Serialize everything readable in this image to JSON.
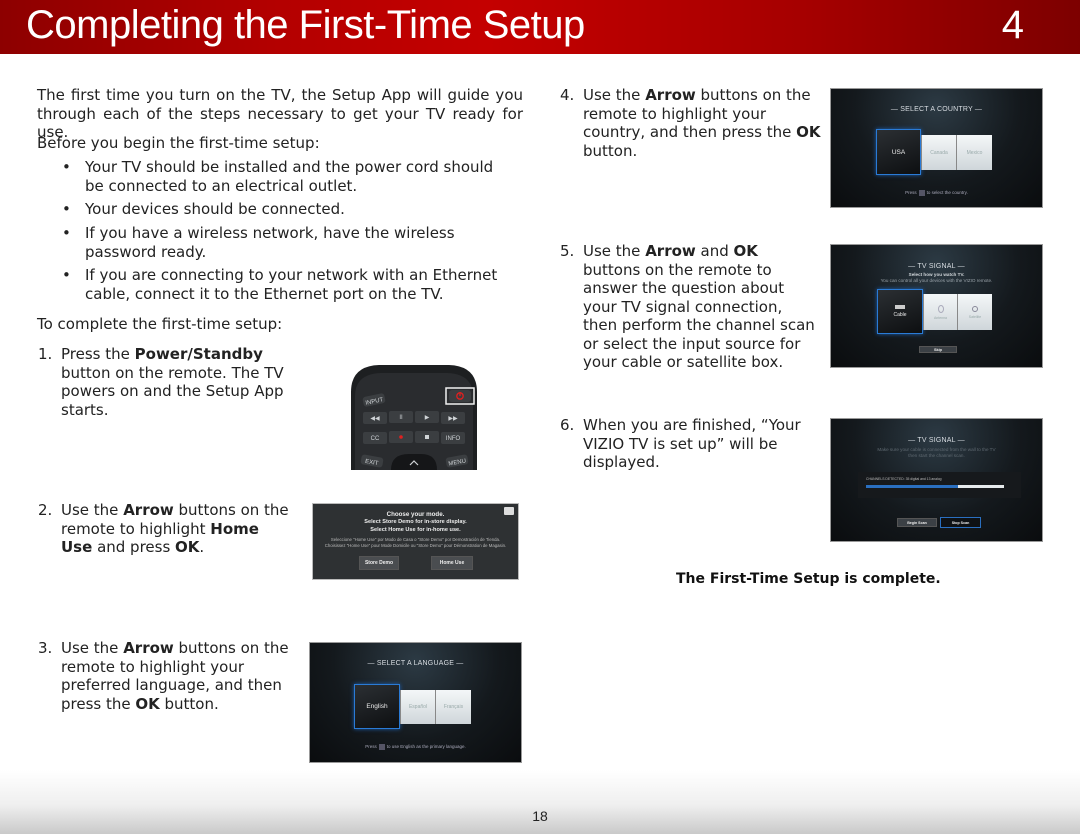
{
  "header": {
    "title": "Completing the First-Time Setup",
    "chapter_number": "4"
  },
  "intro": {
    "paragraph": "The first time you turn on the TV, the Setup App will guide you through each of the steps necessary to get your TV ready for use.",
    "before_label": "Before you begin the first-time setup:",
    "bullets": [
      "Your TV should be installed and the power cord should be connected to an electrical outlet.",
      "Your devices should be connected.",
      "If you have a wireless network, have the wireless password ready.",
      "If you are connecting to your network with an Ethernet cable, connect it to the Ethernet port on the TV."
    ],
    "bullet_glyph": "•",
    "complete_label": "To complete the first-time setup:"
  },
  "steps": [
    {
      "number": "1.",
      "parts": [
        "Press the ",
        "Power/Standby",
        " button on the remote. The TV powers on and the Setup App starts."
      ]
    },
    {
      "number": "2.",
      "parts": [
        "Use the ",
        "Arrow",
        " buttons on the remote to highlight ",
        "Home Use",
        " and press ",
        "OK",
        "."
      ]
    },
    {
      "number": "3.",
      "parts": [
        "Use the ",
        "Arrow",
        " buttons on the remote to highlight your preferred language, and then press the ",
        "OK",
        " button."
      ]
    },
    {
      "number": "4.",
      "parts": [
        "Use the ",
        "Arrow",
        " buttons on the remote to highlight your country, and then press the ",
        "OK",
        " button."
      ]
    },
    {
      "number": "5.",
      "parts": [
        "Use the ",
        "Arrow",
        " and ",
        "OK",
        " buttons on the remote to answer the question about your TV signal connection, then perform the channel scan or select the input source for your cable or satellite box."
      ]
    },
    {
      "number": "6.",
      "parts": [
        "When you are finished, “Your VIZIO TV is set up” will be displayed."
      ]
    }
  ],
  "remote": {
    "buttons": [
      "INPUT",
      "⏪",
      "II",
      "▶",
      "⏩",
      "CC",
      "●",
      "■",
      "INFO",
      "EXIT",
      "^",
      "MENU"
    ],
    "power_color": "#e02020"
  },
  "mode_screen": {
    "title": "Choose your mode.",
    "line1": "Select Store Demo for in-store display.",
    "line2": "Select Home Use for in-home use.",
    "spanish": "Seleccione \"Home Use\" por Modo de Casa o \"Store Demo\" por Demostración de Tienda.",
    "french": "Choisissez \"Home Use\" pour Mode Domicile ou \"Store Demo\" pour Démonstration de Magasin.",
    "buttons": [
      "Store Demo",
      "Home Use"
    ]
  },
  "language_screen": {
    "title": "SELECT A LANGUAGE",
    "options": [
      "English",
      "Español",
      "Français"
    ],
    "selected": "English",
    "hint_before": "Press",
    "hint_after": "to use English as the primary language."
  },
  "country_screen": {
    "title": "SELECT A COUNTRY",
    "options": [
      "USA",
      "Canada",
      "Mexico"
    ],
    "selected": "USA",
    "hint_before": "Press",
    "hint_after": "to select the country."
  },
  "signal_screen": {
    "title": "TV SIGNAL",
    "subtitle": "Select how you watch TV.",
    "subtitle2": "You can control all your devices with the VIZIO remote.",
    "options": [
      "Cable",
      "Antenna",
      "Satellite"
    ],
    "selected": "Cable",
    "skip": "Skip"
  },
  "scan_screen": {
    "title": "TV SIGNAL",
    "subtitle": "Make sure your cable is connected from the wall to the TV",
    "subtitle2": "then start the channel scan.",
    "status": "CHANNELS DETECTED: 35 digital and 13 analog",
    "progress_percent": 67,
    "buttons": [
      "Begin Scan",
      "Stop Scan"
    ],
    "selected_button": "Stop Scan"
  },
  "completion": "The First-Time Setup is complete.",
  "page_number": "18",
  "colors": {
    "banner_red": "#c40000",
    "highlight_blue": "#2a7bd6"
  }
}
